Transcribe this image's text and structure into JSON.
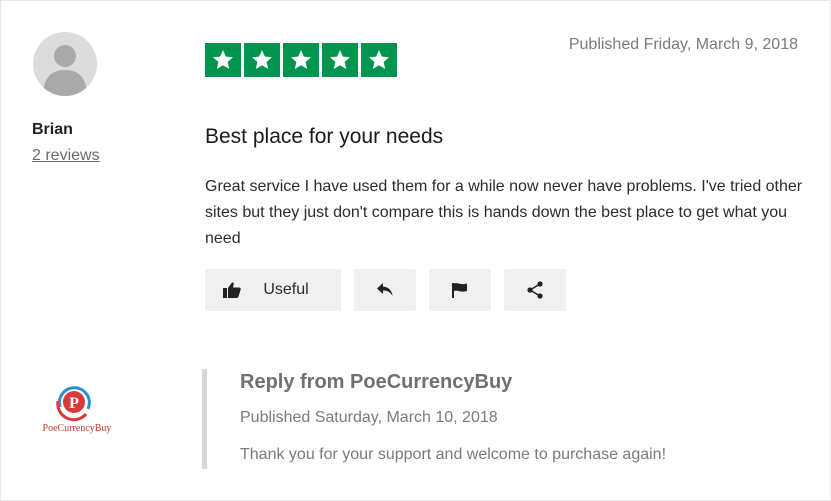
{
  "review": {
    "reviewer": {
      "name": "Brian",
      "reviews_count": "2 reviews"
    },
    "rating": 5,
    "published": "Published Friday, March 9, 2018",
    "title": "Best place for your needs",
    "body": "Great service I have used them for a while now never have problems. I've tried other sites but they just don't compare this is hands down the best place to get what you need",
    "actions": {
      "useful_label": "Useful",
      "useful_icon": "thumbs-up-icon",
      "reply_icon": "reply-icon",
      "flag_icon": "flag-icon",
      "share_icon": "share-icon"
    },
    "star_color": "#00944f"
  },
  "reply": {
    "title": "Reply from PoeCurrencyBuy",
    "published": "Published Saturday, March 10, 2018",
    "body": "Thank you for your support and welcome to purchase again!",
    "company_logo_text": "PoeCurrencyBuy"
  }
}
